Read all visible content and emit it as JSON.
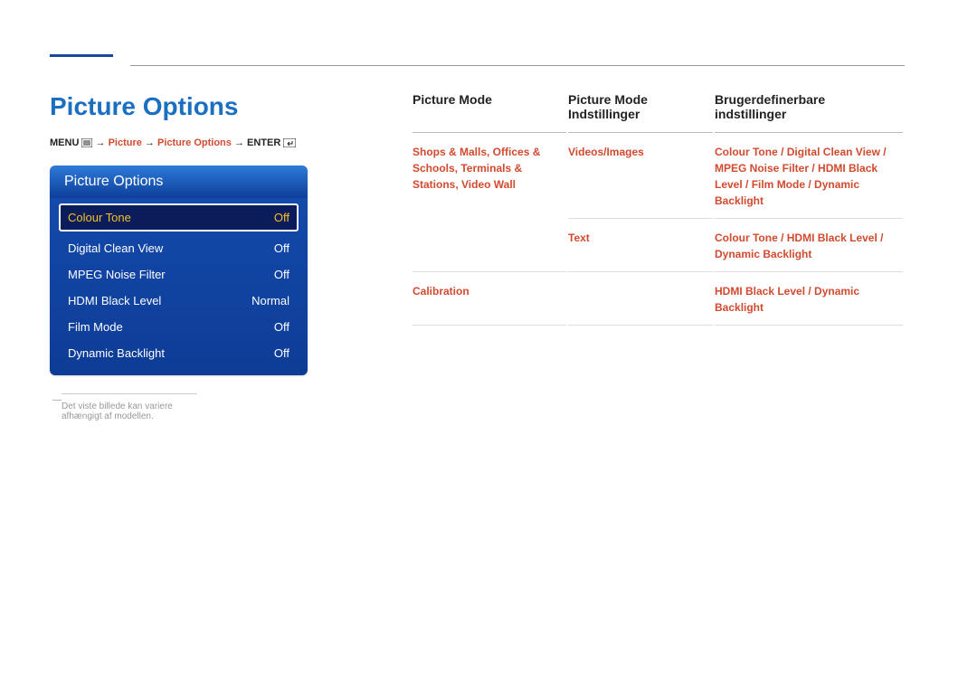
{
  "title": "Picture Options",
  "breadcrumb": {
    "menu_label": "MENU",
    "arrow": "→",
    "seg1": "Picture",
    "seg2": "Picture Options",
    "enter_label": "ENTER"
  },
  "osd": {
    "header": "Picture Options",
    "rows": [
      {
        "label": "Colour Tone",
        "value": "Off",
        "selected": true
      },
      {
        "label": "Digital Clean View",
        "value": "Off",
        "selected": false
      },
      {
        "label": "MPEG Noise Filter",
        "value": "Off",
        "selected": false
      },
      {
        "label": "HDMI Black Level",
        "value": "Normal",
        "selected": false
      },
      {
        "label": "Film Mode",
        "value": "Off",
        "selected": false
      },
      {
        "label": "Dynamic Backlight",
        "value": "Off",
        "selected": false
      }
    ]
  },
  "footnote": "Det viste billede kan variere afhængigt af modellen.",
  "table": {
    "headers": [
      "Picture Mode",
      "Picture Mode Indstillinger",
      "Brugerdefinerbare indstillinger"
    ],
    "rows": [
      {
        "c1": "Shops & Malls, Offices & Schools, Terminals & Stations, Video Wall",
        "c2": "Videos/Images",
        "c3": "Colour Tone / Digital Clean View / MPEG Noise Filter / HDMI Black Level / Film Mode / Dynamic Backlight"
      },
      {
        "c1": "",
        "c2": "Text",
        "c3": "Colour Tone / HDMI Black Level / Dynamic Backlight"
      },
      {
        "c1": "Calibration",
        "c2": "",
        "c3": "HDMI Black Level / Dynamic Backlight"
      }
    ]
  }
}
